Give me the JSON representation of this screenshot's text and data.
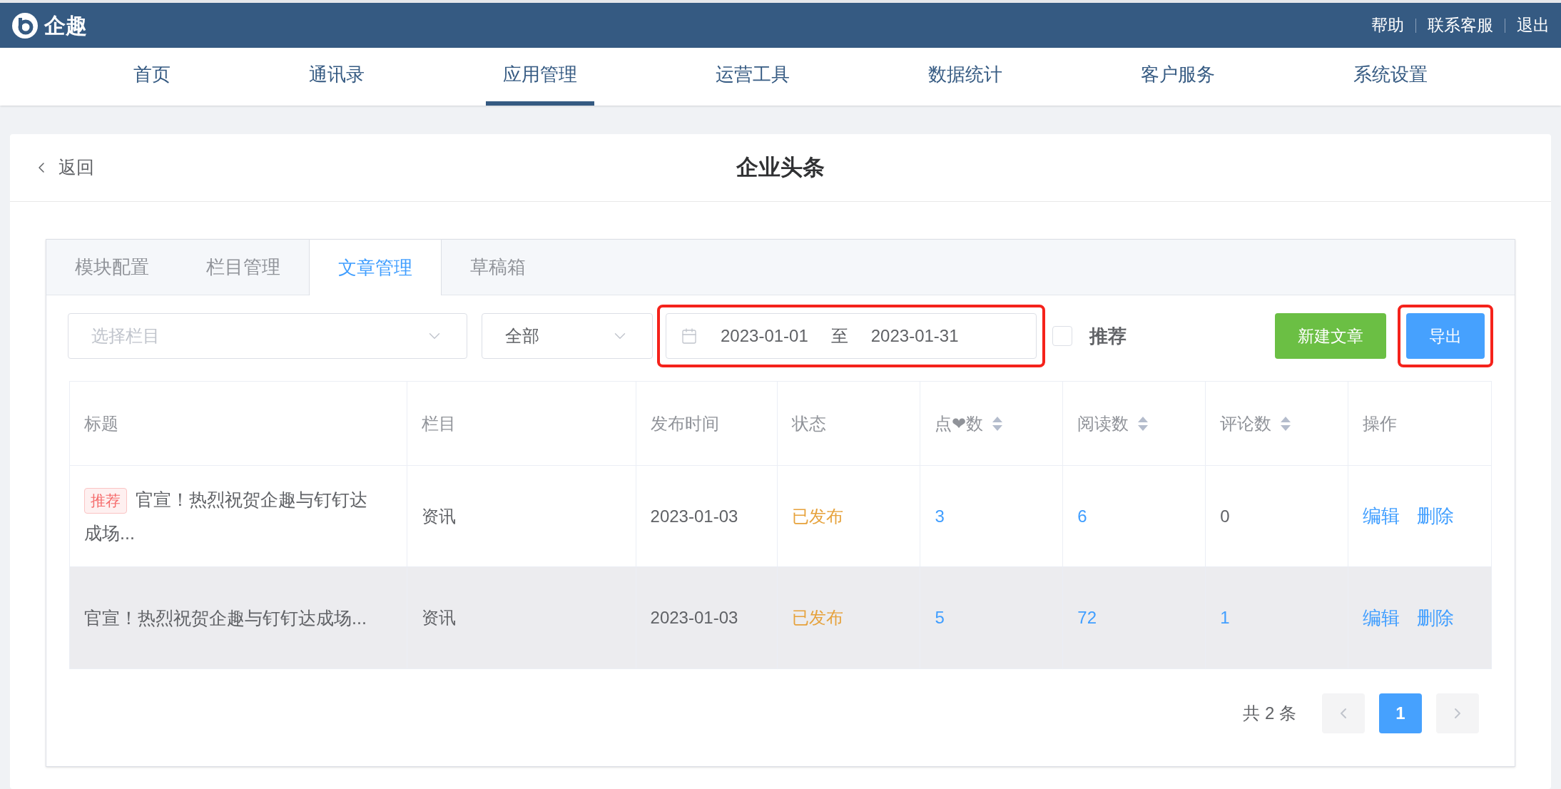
{
  "header": {
    "brand": "企趣",
    "links": [
      "帮助",
      "联系客服",
      "退出"
    ]
  },
  "nav": [
    {
      "label": "首页",
      "selected": false
    },
    {
      "label": "通讯录",
      "selected": false
    },
    {
      "label": "应用管理",
      "selected": true
    },
    {
      "label": "运营工具",
      "selected": false
    },
    {
      "label": "数据统计",
      "selected": false
    },
    {
      "label": "客户服务",
      "selected": false
    },
    {
      "label": "系统设置",
      "selected": false
    }
  ],
  "page": {
    "back": "返回",
    "title": "企业头条"
  },
  "tabs": [
    {
      "label": "模块配置",
      "selected": false
    },
    {
      "label": "栏目管理",
      "selected": false
    },
    {
      "label": "文章管理",
      "selected": true
    },
    {
      "label": "草稿箱",
      "selected": false
    }
  ],
  "filters": {
    "column_select": {
      "placeholder": "选择栏目"
    },
    "status_select": {
      "value": "全部"
    },
    "date_range": {
      "start": "2023-01-01",
      "separator": "至",
      "end": "2023-01-31",
      "annotated": true
    },
    "recommend": {
      "label": "推荐",
      "checked": false
    }
  },
  "buttons": [
    {
      "label": "新建文章",
      "kind": "success",
      "annotated": false
    },
    {
      "label": "导出",
      "kind": "primary",
      "annotated": true
    }
  ],
  "table": {
    "columns": [
      {
        "label": "标题",
        "sortable": false
      },
      {
        "label": "栏目",
        "sortable": false
      },
      {
        "label": "发布时间",
        "sortable": false
      },
      {
        "label": "状态",
        "sortable": false
      },
      {
        "label": "点❤数",
        "sortable": true
      },
      {
        "label": "阅读数",
        "sortable": true
      },
      {
        "label": "评论数",
        "sortable": true
      },
      {
        "label": "操作",
        "sortable": false
      }
    ],
    "rows": [
      {
        "hovered": false,
        "badge": "推荐",
        "title": "官宣！热烈祝贺企趣与钉钉达成场...",
        "column": "资讯",
        "date": "2023-01-03",
        "status": "已发布",
        "likes": {
          "text": "3",
          "linked": true
        },
        "reads": {
          "text": "6",
          "linked": true
        },
        "comments": {
          "text": "0",
          "linked": false
        },
        "actions": [
          "编辑",
          "删除"
        ]
      },
      {
        "hovered": true,
        "title": "官宣！热烈祝贺企趣与钉钉达成场...",
        "column": "资讯",
        "date": "2023-01-03",
        "status": "已发布",
        "likes": {
          "text": "5",
          "linked": true
        },
        "reads": {
          "text": "72",
          "linked": true
        },
        "comments": {
          "text": "1",
          "linked": true
        },
        "actions": [
          "编辑",
          "删除"
        ]
      }
    ]
  },
  "pagination": {
    "total": "共 2 条",
    "pages": [
      {
        "label": "1",
        "selected": true
      }
    ]
  }
}
